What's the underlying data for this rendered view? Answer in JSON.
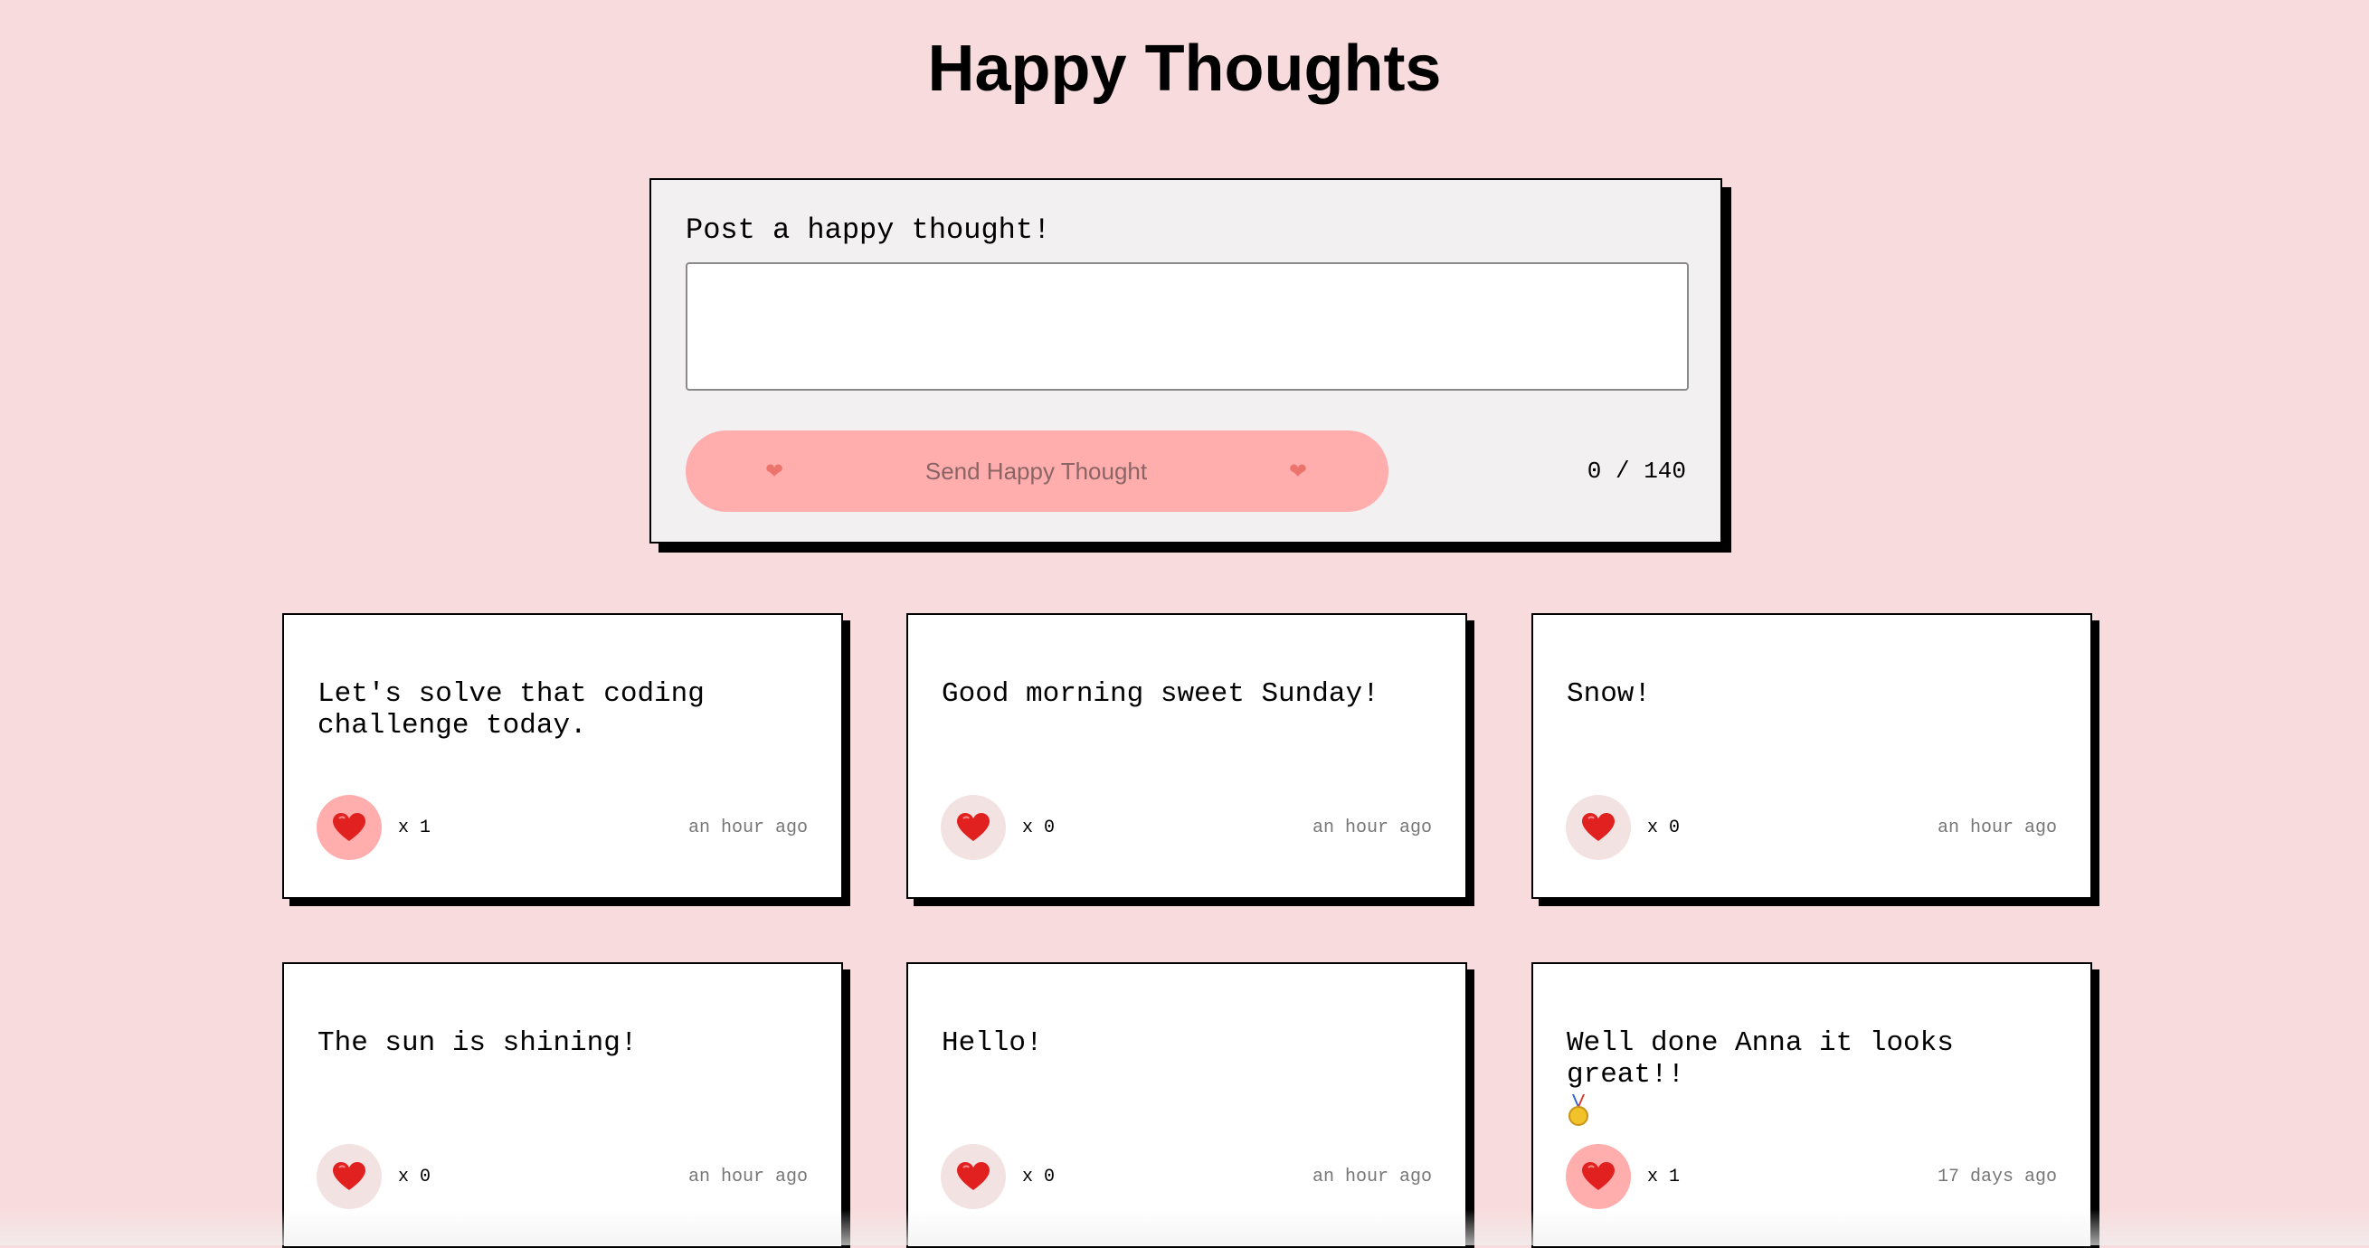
{
  "header": {
    "title": "Happy Thoughts"
  },
  "form": {
    "label": "Post a happy thought!",
    "input_value": "",
    "button": {
      "label": "Send Happy Thought",
      "left_icon": "heart-icon",
      "right_icon": "heart-icon"
    },
    "char_count": "0 / 140"
  },
  "thoughts": [
    {
      "message": "Let's solve that coding challenge today.",
      "likes": "x 1",
      "time": "an hour ago",
      "liked": true
    },
    {
      "message": "Good morning sweet Sunday!",
      "likes": "x 0",
      "time": "an hour ago",
      "liked": false
    },
    {
      "message": "Snow!",
      "likes": "x 0",
      "time": "an hour ago",
      "liked": false
    },
    {
      "message": "The sun is shining!",
      "likes": "x 0",
      "time": "an hour ago",
      "liked": false
    },
    {
      "message": "Hello!",
      "likes": "x 0",
      "time": "an hour ago",
      "liked": false
    },
    {
      "message": "Well done Anna it looks great!!",
      "emoji": "medal-icon",
      "likes": "x 1",
      "time": "17 days ago",
      "liked": true
    }
  ],
  "colors": {
    "background": "#f8dcdd",
    "button": "#ffadad",
    "heart": "#e0211f"
  }
}
